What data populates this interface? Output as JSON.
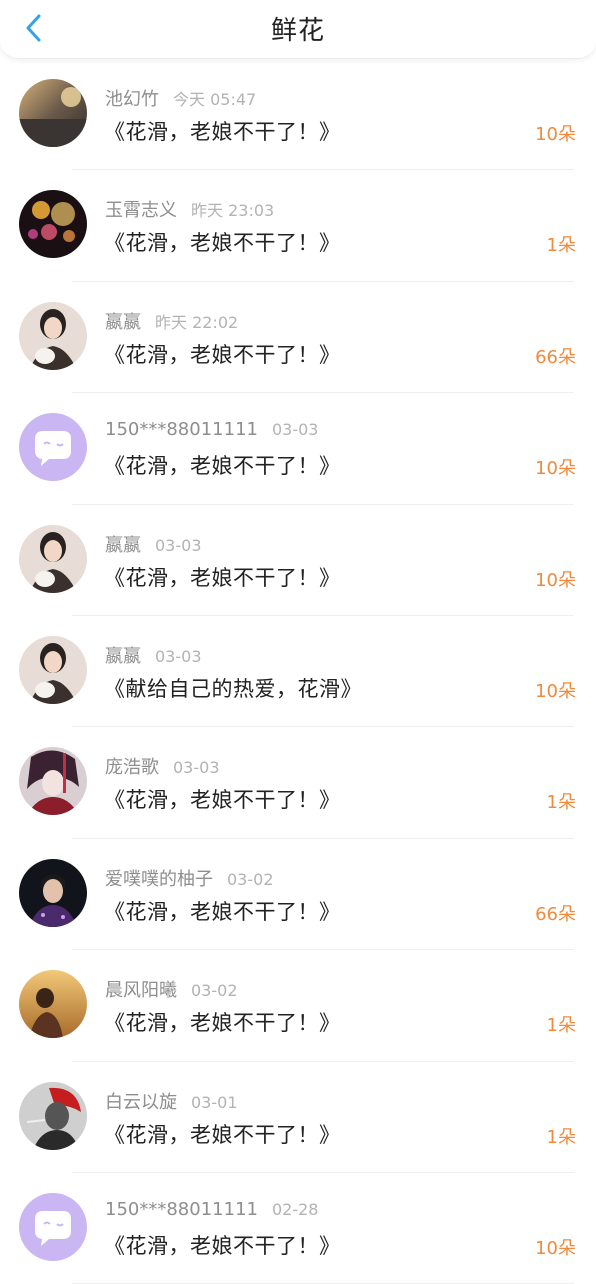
{
  "header": {
    "title": "鲜花",
    "back_icon": "chevron-left-icon",
    "accent": "#2fa3f0"
  },
  "colors": {
    "count": "#f08a3c",
    "name": "#8e8e8e",
    "time": "#b3b3b3"
  },
  "records": [
    {
      "name": "池幻竹",
      "time": "今天 05:47",
      "gift": "《花滑，老娘不干了！》",
      "count": "10朵",
      "avatar": "sunset-photo-avatar"
    },
    {
      "name": "玉霄志义",
      "time": "昨天 23:03",
      "gift": "《花滑，老娘不干了！》",
      "count": "1朵",
      "avatar": "bokeh-lights-avatar"
    },
    {
      "name": "嬴嬴",
      "time": "昨天 22:02",
      "gift": "《花滑，老娘不干了！》",
      "count": "66朵",
      "avatar": "girl-with-cat-avatar"
    },
    {
      "name": "150***88011111",
      "time": "03-03",
      "gift": "《花滑，老娘不干了！》",
      "count": "10朵",
      "avatar": "default-chat-bubble-avatar"
    },
    {
      "name": "嬴嬴",
      "time": "03-03",
      "gift": "《花滑，老娘不干了！》",
      "count": "10朵",
      "avatar": "girl-with-cat-avatar"
    },
    {
      "name": "嬴嬴",
      "time": "03-03",
      "gift": "《献给自己的热爱，花滑》",
      "count": "10朵",
      "avatar": "girl-with-cat-avatar"
    },
    {
      "name": "庞浩歌",
      "time": "03-03",
      "gift": "《花滑，老娘不干了！》",
      "count": "1朵",
      "avatar": "anime-character-avatar"
    },
    {
      "name": "爱噗噗的柚子",
      "time": "03-02",
      "gift": "《花滑，老娘不干了！》",
      "count": "66朵",
      "avatar": "man-portrait-avatar"
    },
    {
      "name": "晨风阳曦",
      "time": "03-02",
      "gift": "《花滑，老娘不干了！》",
      "count": "1朵",
      "avatar": "golden-field-avatar"
    },
    {
      "name": "白云以旋",
      "time": "03-01",
      "gift": "《花滑，老娘不干了！》",
      "count": "1朵",
      "avatar": "red-hair-smoking-avatar"
    },
    {
      "name": "150***88011111",
      "time": "02-28",
      "gift": "《花滑，老娘不干了！》",
      "count": "10朵",
      "avatar": "default-chat-bubble-avatar"
    }
  ]
}
